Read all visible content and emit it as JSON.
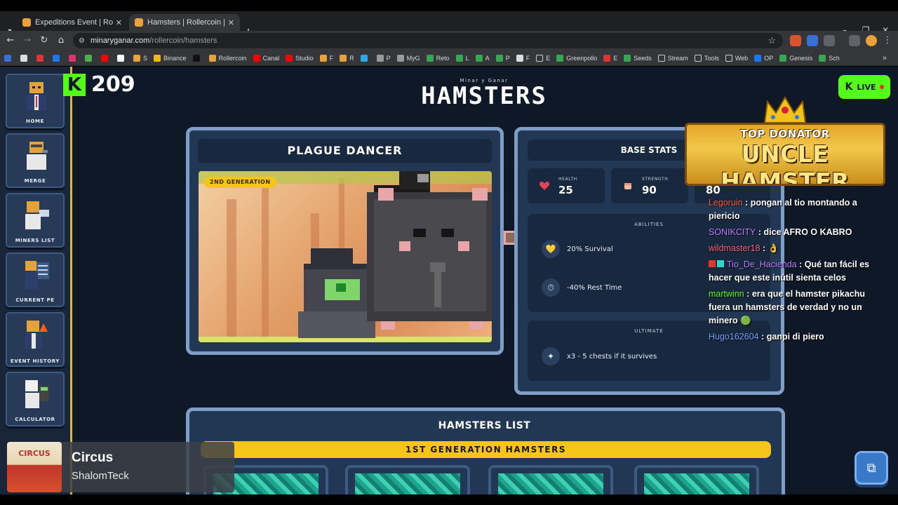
{
  "browser": {
    "tabs": [
      {
        "title": "Expeditions Event | RollerCoin",
        "active": false
      },
      {
        "title": "Hamsters | Rollercoin | Minar y",
        "active": true
      }
    ],
    "url_host": "minaryganar.com",
    "url_path": "/rollercoin/hamsters",
    "bookmarks": [
      "S",
      "Binance",
      "Rollercoin",
      "Canal",
      "Studio",
      "F",
      "R",
      "P",
      "MyG",
      "Reto",
      "L",
      "A",
      "P",
      "F",
      "E",
      "Greenpollo",
      "E",
      "Seeds",
      "Stream",
      "Tools",
      "Web",
      "OP",
      "Genesis",
      "Sch"
    ]
  },
  "sidebar": {
    "items": [
      {
        "label": "HOME"
      },
      {
        "label": "MERGE"
      },
      {
        "label": "MINERS LIST"
      },
      {
        "label": "CURRENT PE"
      },
      {
        "label": "EVENT HISTORY"
      },
      {
        "label": "CALCULATOR"
      }
    ]
  },
  "overlay": {
    "kick_logo": "K",
    "viewer_count": "209",
    "live_label": "LIVE",
    "donator_top": "TOP DONATOR",
    "donator_name": "UNCLE HAMSTER"
  },
  "header": {
    "subtitle": "Minar y Ganar",
    "title": "HAMSTERS"
  },
  "hamster": {
    "name": "PLAGUE DANCER",
    "generation": "2ND GENERATION"
  },
  "stats": {
    "title": "BASE STATS",
    "items": [
      {
        "label": "HEALTH",
        "value": "25",
        "icon": "heart-icon"
      },
      {
        "label": "STRENGTH",
        "value": "90",
        "icon": "fist-icon"
      },
      {
        "label": "",
        "value": "80",
        "icon": "coin-icon"
      }
    ],
    "abilities_title": "ABILITIES",
    "abilities": [
      {
        "text": "20% Survival",
        "icon": "heart-icon"
      },
      {
        "text": "-40% Rest Time",
        "icon": "clock-icon"
      }
    ],
    "ultimate_title": "ULTIMATE",
    "ultimate": {
      "text": "x3 - 5 chests if it survives",
      "icon": "chest-icon"
    }
  },
  "chat": [
    {
      "user": "Legoruin",
      "user_color": "#ff5a3c",
      "text": " : pongan al tio montando a piericio"
    },
    {
      "user": "SONIKCITY",
      "user_color": "#c07cff",
      "text": " : dice AFRO O KABRO"
    },
    {
      "user": "wildmaster18",
      "user_color": "#ff5f7a",
      "text": " : "
    },
    {
      "user": "Tio_De_Hacienda",
      "user_color": "#b87cff",
      "text": " : Qué tan fácil es hacer que este inútil sienta celos"
    },
    {
      "user": "martwinn",
      "user_color": "#53fc18",
      "text": " : era que el hamster pikachu fuera un hamsters de verdad y no un minero "
    },
    {
      "user": "Hugo162604",
      "user_color": "#6ea6ff",
      "text": " : ganpi di piero"
    }
  ],
  "list": {
    "title": "HAMSTERS LIST",
    "generation_header": "1ST GENERATION HAMSTERS"
  },
  "now_playing": {
    "thumb_text": "CIRCUS",
    "title": "Circus",
    "artist": "ShalomTeck"
  }
}
